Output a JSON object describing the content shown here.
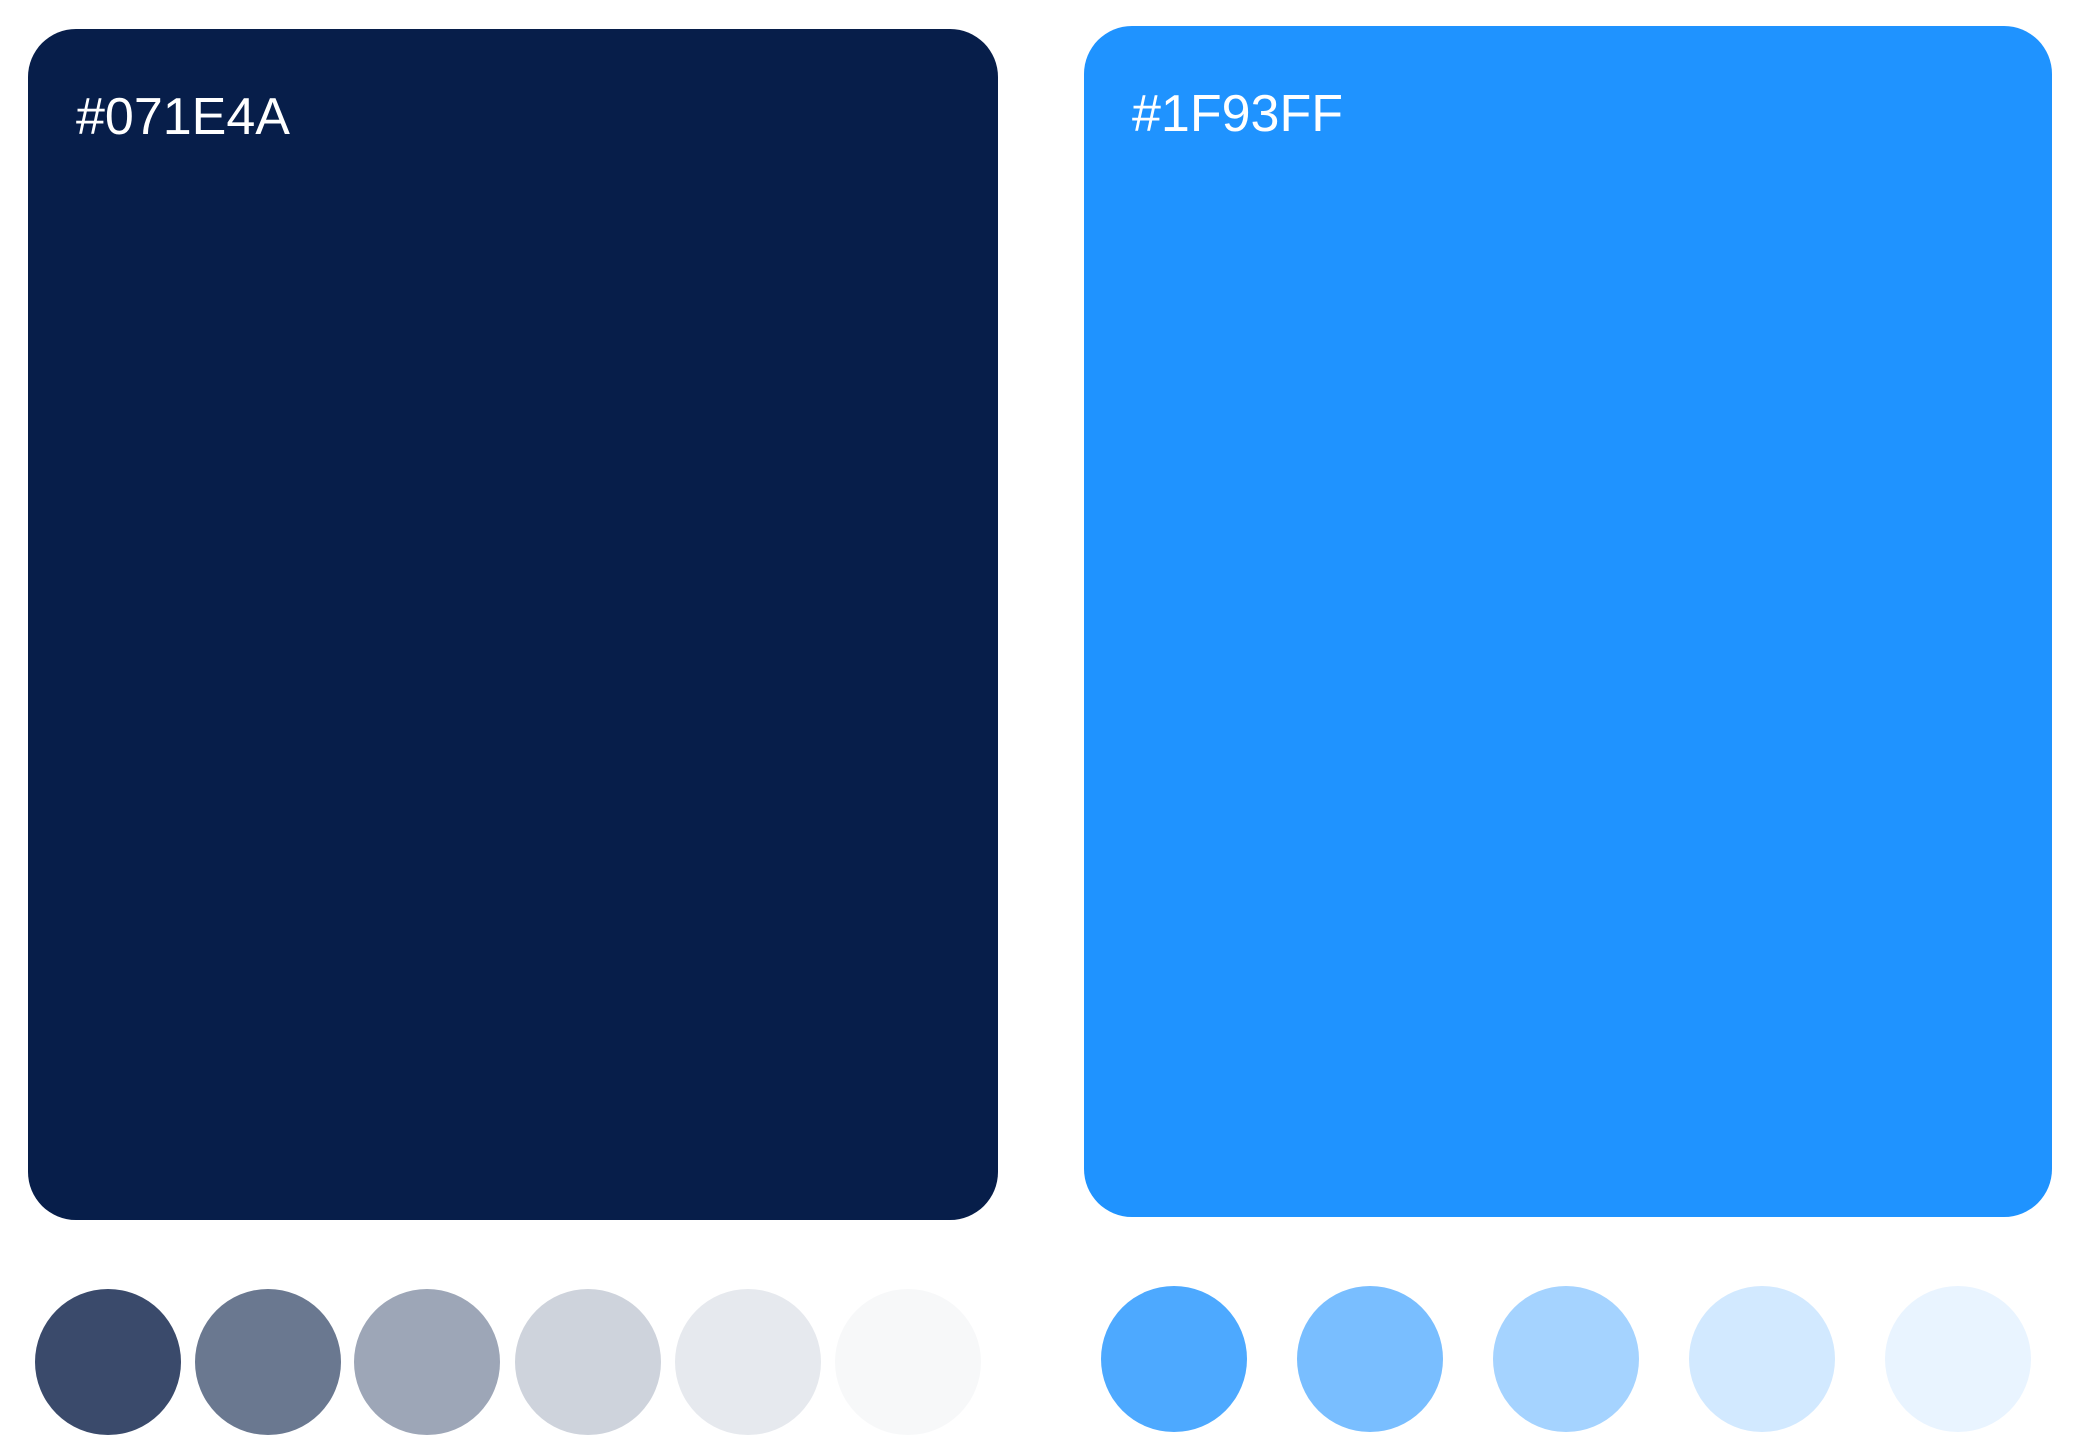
{
  "palettes": [
    {
      "hex": "#071E4A",
      "label": "#071E4A",
      "tints": [
        "#3A4A6B",
        "#6A7890",
        "#9DA6B7",
        "#CED3DC",
        "#E6E9EE",
        "#F7F8F9"
      ]
    },
    {
      "hex": "#1F93FF",
      "label": "#1F93FF",
      "tints": [
        "#4DA9FF",
        "#79BEFF",
        "#A5D3FF",
        "#D2E9FF",
        "#E9F4FF"
      ]
    }
  ]
}
